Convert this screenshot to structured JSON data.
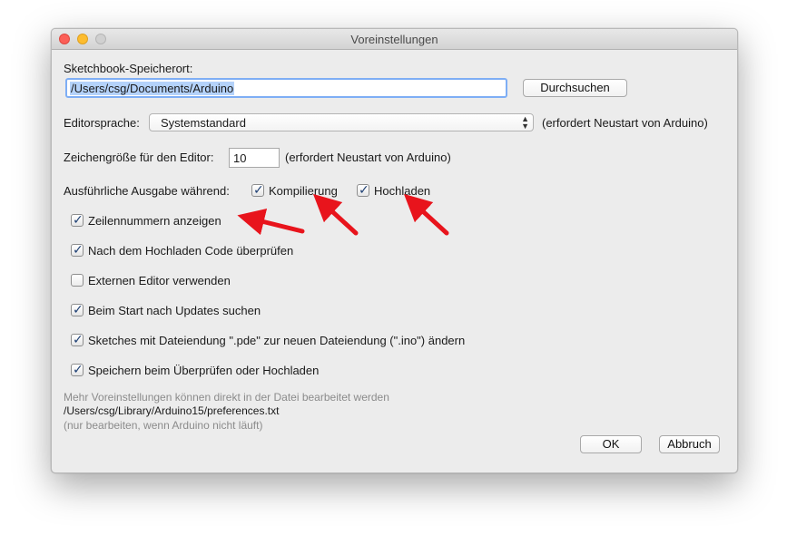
{
  "window": {
    "title": "Voreinstellungen"
  },
  "sketchbook": {
    "label": "Sketchbook-Speicherort:",
    "path_value": "/Users/csg/Documents/Arduino",
    "browse_label": "Durchsuchen"
  },
  "editor_language": {
    "label": "Editorsprache:",
    "selected": "Systemstandard",
    "note": "(erfordert Neustart von Arduino)"
  },
  "font_size": {
    "label": "Zeichengröße für den Editor:",
    "value": "10",
    "note": "(erfordert Neustart von Arduino)"
  },
  "verbose": {
    "label": "Ausführliche Ausgabe während:",
    "compile_label": "Kompilierung",
    "compile_checked": true,
    "upload_label": "Hochladen",
    "upload_checked": true
  },
  "options": [
    {
      "label": "Zeilennummern anzeigen",
      "checked": true
    },
    {
      "label": "Nach dem Hochladen Code überprüfen",
      "checked": true
    },
    {
      "label": "Externen Editor verwenden",
      "checked": false
    },
    {
      "label": "Beim Start nach Updates suchen",
      "checked": true
    },
    {
      "label": "Sketches mit Dateiendung \".pde\" zur neuen Dateiendung (\".ino\") ändern",
      "checked": true
    },
    {
      "label": "Speichern beim Überprüfen oder Hochladen",
      "checked": true
    }
  ],
  "footer": {
    "more_prefs": "Mehr Voreinstellungen können direkt in der Datei bearbeitet werden",
    "prefs_path": "/Users/csg/Library/Arduino15/preferences.txt",
    "edit_note": "(nur bearbeiten, wenn Arduino nicht läuft)"
  },
  "buttons": {
    "ok_label": "OK",
    "cancel_label": "Abbruch"
  },
  "colors": {
    "annotation_arrow": "#e8141c",
    "check_mark": "#1d3f73",
    "focus_ring": "#7eaef5"
  }
}
